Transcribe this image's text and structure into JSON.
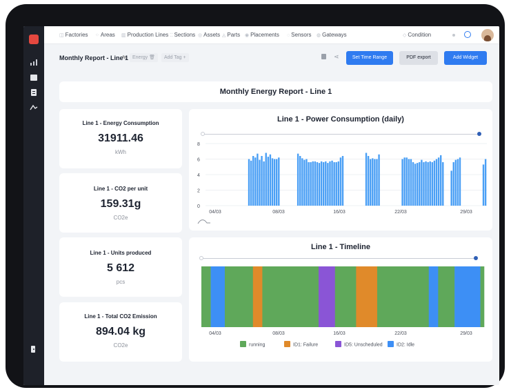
{
  "nav": {
    "items": [
      {
        "label": "Factories",
        "icon": "factory-icon"
      },
      {
        "label": "Areas",
        "icon": "area-icon"
      },
      {
        "label": "Production Lines",
        "icon": "production-line-icon"
      },
      {
        "label": "Sections",
        "icon": "section-icon"
      },
      {
        "label": "Assets",
        "icon": "asset-icon"
      },
      {
        "label": "Parts",
        "icon": "part-icon"
      },
      {
        "label": "Placements",
        "icon": "placement-icon"
      },
      {
        "label": "Sensors",
        "icon": "sensor-icon"
      },
      {
        "label": "Gateways",
        "icon": "gateway-icon"
      }
    ],
    "condition_label": "Condition"
  },
  "toolbar": {
    "report_title": "Monthly Report - Line 1",
    "tag_energy": "Energy",
    "tag_add": "Add Tag +",
    "set_time_range": "Set Time Range",
    "pdf_export": "PDF export",
    "add_widget": "Add Widget"
  },
  "dashboard": {
    "title": "Monthly Energy Report - Line 1",
    "kpis": [
      {
        "label": "Line 1 - Energy Consumption",
        "value": "31911.46",
        "unit": "kWh"
      },
      {
        "label": "Line 1 - CO2 per unit",
        "value": "159.31g",
        "unit": "CO2e"
      },
      {
        "label": "Line 1 - Units produced",
        "value": "5 612",
        "unit": "pcs"
      },
      {
        "label": "Line 1 - Total CO2 Emission",
        "value": "894.04 kg",
        "unit": "CO2e"
      }
    ]
  },
  "colors": {
    "accent": "#2f7bf0",
    "bar": "#4a9ff5",
    "running": "#5fa85a",
    "failure": "#e08a2a",
    "unscheduled": "#8a55d6",
    "idle": "#3d8ff5"
  },
  "chart_data": [
    {
      "type": "bar",
      "title": "Line 1 - Power Consumption (daily)",
      "ylim": [
        0,
        8
      ],
      "yticks": [
        0,
        2,
        4,
        6,
        8
      ],
      "xtick_labels": [
        "04/03",
        "08/03",
        "16/03",
        "22/03",
        "29/03"
      ],
      "values": [
        0,
        0,
        0,
        0,
        0,
        0,
        0,
        0,
        0,
        0,
        0,
        0,
        0,
        0,
        0,
        0,
        0,
        0,
        0,
        0,
        6.0,
        5.8,
        6.4,
        6.2,
        6.7,
        5.9,
        6.4,
        5.7,
        6.8,
        6.3,
        6.6,
        6.1,
        6.0,
        6.0,
        6.2,
        0,
        0,
        0,
        0,
        0,
        0,
        0,
        0,
        6.7,
        6.4,
        6.1,
        5.9,
        6.0,
        5.6,
        5.6,
        5.7,
        5.7,
        5.6,
        5.5,
        5.7,
        5.6,
        5.7,
        5.5,
        5.7,
        5.8,
        5.6,
        5.6,
        5.7,
        6.2,
        6.4,
        0,
        0,
        0,
        0,
        0,
        0,
        0,
        0,
        0,
        0,
        6.8,
        6.4,
        6.0,
        6.1,
        6.0,
        6.0,
        6.6,
        0,
        0,
        0,
        0,
        0,
        0,
        0,
        0,
        0,
        0,
        6.0,
        6.2,
        6.2,
        6.0,
        6.0,
        5.6,
        5.4,
        5.5,
        5.6,
        5.9,
        5.6,
        5.7,
        5.6,
        5.7,
        5.6,
        5.8,
        6.0,
        6.2,
        6.5,
        5.6,
        0,
        0,
        0,
        4.5,
        5.6,
        5.9,
        6.0,
        6.2,
        0,
        0,
        0,
        0,
        0,
        0,
        0,
        0,
        0,
        0,
        5.3,
        6.0
      ]
    },
    {
      "type": "timeline",
      "title": "Line 1 - Timeline",
      "xtick_labels": [
        "04/03",
        "08/03",
        "16/03",
        "22/03",
        "29/03"
      ],
      "states": [
        "running",
        "ID1: Failure",
        "ID5: Unscheduled",
        "ID2: Idle"
      ],
      "segments": [
        {
          "state": "running",
          "duration": 2
        },
        {
          "state": "ID2: Idle",
          "duration": 3
        },
        {
          "state": "running",
          "duration": 6
        },
        {
          "state": "ID1: Failure",
          "duration": 2
        },
        {
          "state": "running",
          "duration": 12
        },
        {
          "state": "ID5: Unscheduled",
          "duration": 3.5
        },
        {
          "state": "running",
          "duration": 4.5
        },
        {
          "state": "ID1: Failure",
          "duration": 4.5
        },
        {
          "state": "running",
          "duration": 11
        },
        {
          "state": "ID2: Idle",
          "duration": 2
        },
        {
          "state": "running",
          "duration": 3.5
        },
        {
          "state": "ID2: Idle",
          "duration": 5.5
        },
        {
          "state": "running",
          "duration": 0.8
        }
      ],
      "legend": [
        "running",
        "ID1: Failure",
        "ID5: Unscheduled",
        "ID2: Idle"
      ]
    }
  ]
}
